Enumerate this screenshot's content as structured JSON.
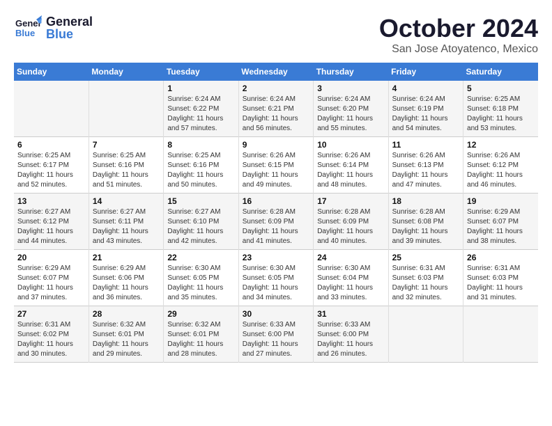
{
  "header": {
    "logo_general": "General",
    "logo_blue": "Blue",
    "title": "October 2024",
    "subtitle": "San Jose Atoyatenco, Mexico"
  },
  "days_of_week": [
    "Sunday",
    "Monday",
    "Tuesday",
    "Wednesday",
    "Thursday",
    "Friday",
    "Saturday"
  ],
  "weeks": [
    [
      {
        "day": "",
        "info": ""
      },
      {
        "day": "",
        "info": ""
      },
      {
        "day": "1",
        "info": "Sunrise: 6:24 AM\nSunset: 6:22 PM\nDaylight: 11 hours and 57 minutes."
      },
      {
        "day": "2",
        "info": "Sunrise: 6:24 AM\nSunset: 6:21 PM\nDaylight: 11 hours and 56 minutes."
      },
      {
        "day": "3",
        "info": "Sunrise: 6:24 AM\nSunset: 6:20 PM\nDaylight: 11 hours and 55 minutes."
      },
      {
        "day": "4",
        "info": "Sunrise: 6:24 AM\nSunset: 6:19 PM\nDaylight: 11 hours and 54 minutes."
      },
      {
        "day": "5",
        "info": "Sunrise: 6:25 AM\nSunset: 6:18 PM\nDaylight: 11 hours and 53 minutes."
      }
    ],
    [
      {
        "day": "6",
        "info": "Sunrise: 6:25 AM\nSunset: 6:17 PM\nDaylight: 11 hours and 52 minutes."
      },
      {
        "day": "7",
        "info": "Sunrise: 6:25 AM\nSunset: 6:16 PM\nDaylight: 11 hours and 51 minutes."
      },
      {
        "day": "8",
        "info": "Sunrise: 6:25 AM\nSunset: 6:16 PM\nDaylight: 11 hours and 50 minutes."
      },
      {
        "day": "9",
        "info": "Sunrise: 6:26 AM\nSunset: 6:15 PM\nDaylight: 11 hours and 49 minutes."
      },
      {
        "day": "10",
        "info": "Sunrise: 6:26 AM\nSunset: 6:14 PM\nDaylight: 11 hours and 48 minutes."
      },
      {
        "day": "11",
        "info": "Sunrise: 6:26 AM\nSunset: 6:13 PM\nDaylight: 11 hours and 47 minutes."
      },
      {
        "day": "12",
        "info": "Sunrise: 6:26 AM\nSunset: 6:12 PM\nDaylight: 11 hours and 46 minutes."
      }
    ],
    [
      {
        "day": "13",
        "info": "Sunrise: 6:27 AM\nSunset: 6:12 PM\nDaylight: 11 hours and 44 minutes."
      },
      {
        "day": "14",
        "info": "Sunrise: 6:27 AM\nSunset: 6:11 PM\nDaylight: 11 hours and 43 minutes."
      },
      {
        "day": "15",
        "info": "Sunrise: 6:27 AM\nSunset: 6:10 PM\nDaylight: 11 hours and 42 minutes."
      },
      {
        "day": "16",
        "info": "Sunrise: 6:28 AM\nSunset: 6:09 PM\nDaylight: 11 hours and 41 minutes."
      },
      {
        "day": "17",
        "info": "Sunrise: 6:28 AM\nSunset: 6:09 PM\nDaylight: 11 hours and 40 minutes."
      },
      {
        "day": "18",
        "info": "Sunrise: 6:28 AM\nSunset: 6:08 PM\nDaylight: 11 hours and 39 minutes."
      },
      {
        "day": "19",
        "info": "Sunrise: 6:29 AM\nSunset: 6:07 PM\nDaylight: 11 hours and 38 minutes."
      }
    ],
    [
      {
        "day": "20",
        "info": "Sunrise: 6:29 AM\nSunset: 6:07 PM\nDaylight: 11 hours and 37 minutes."
      },
      {
        "day": "21",
        "info": "Sunrise: 6:29 AM\nSunset: 6:06 PM\nDaylight: 11 hours and 36 minutes."
      },
      {
        "day": "22",
        "info": "Sunrise: 6:30 AM\nSunset: 6:05 PM\nDaylight: 11 hours and 35 minutes."
      },
      {
        "day": "23",
        "info": "Sunrise: 6:30 AM\nSunset: 6:05 PM\nDaylight: 11 hours and 34 minutes."
      },
      {
        "day": "24",
        "info": "Sunrise: 6:30 AM\nSunset: 6:04 PM\nDaylight: 11 hours and 33 minutes."
      },
      {
        "day": "25",
        "info": "Sunrise: 6:31 AM\nSunset: 6:03 PM\nDaylight: 11 hours and 32 minutes."
      },
      {
        "day": "26",
        "info": "Sunrise: 6:31 AM\nSunset: 6:03 PM\nDaylight: 11 hours and 31 minutes."
      }
    ],
    [
      {
        "day": "27",
        "info": "Sunrise: 6:31 AM\nSunset: 6:02 PM\nDaylight: 11 hours and 30 minutes."
      },
      {
        "day": "28",
        "info": "Sunrise: 6:32 AM\nSunset: 6:01 PM\nDaylight: 11 hours and 29 minutes."
      },
      {
        "day": "29",
        "info": "Sunrise: 6:32 AM\nSunset: 6:01 PM\nDaylight: 11 hours and 28 minutes."
      },
      {
        "day": "30",
        "info": "Sunrise: 6:33 AM\nSunset: 6:00 PM\nDaylight: 11 hours and 27 minutes."
      },
      {
        "day": "31",
        "info": "Sunrise: 6:33 AM\nSunset: 6:00 PM\nDaylight: 11 hours and 26 minutes."
      },
      {
        "day": "",
        "info": ""
      },
      {
        "day": "",
        "info": ""
      }
    ]
  ]
}
